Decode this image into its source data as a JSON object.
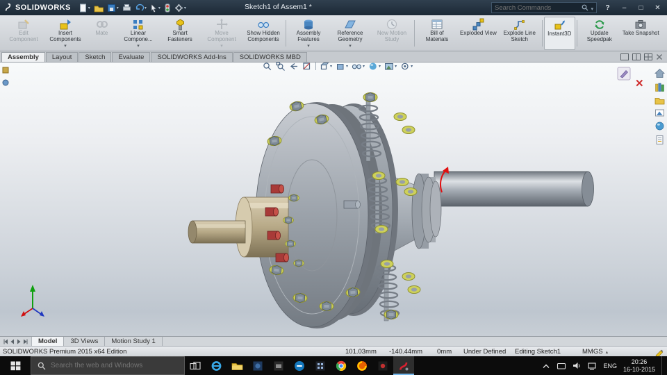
{
  "colors": {
    "titlebar_bg": "#1f2d3b",
    "ribbon_bg": "#d3d7db",
    "viewport_top": "#f8fafb",
    "viewport_bottom": "#c4ccd4",
    "taskbar_bg": "#0c0c0c",
    "taskbar_active_underline": "#76b9ed",
    "washer_yellow": "#c9cc55",
    "bushing_red": "#a83a38",
    "triad_x_red": "#d01010",
    "triad_y_green": "#0fa00f",
    "triad_z_blue": "#2038c0",
    "drag_arrow_red": "#e01010"
  },
  "titlebar": {
    "app_name": "SOLIDWORKS",
    "document_title": "Sketch1 of Assem1 *",
    "search_placeholder": "Search Commands",
    "help_label": "?",
    "minimize_label": "–",
    "maximize_label": "□",
    "close_label": "✕"
  },
  "ribbon": {
    "buttons": [
      {
        "label": "Edit Component",
        "enabled": false,
        "dropdown": false
      },
      {
        "label": "Insert Components",
        "enabled": true,
        "dropdown": true
      },
      {
        "label": "Mate",
        "enabled": false,
        "dropdown": false
      },
      {
        "label": "Linear Compone...",
        "enabled": true,
        "dropdown": true
      },
      {
        "label": "Smart Fasteners",
        "enabled": true,
        "dropdown": false
      },
      {
        "label": "Move Component",
        "enabled": false,
        "dropdown": true
      },
      {
        "label": "Show Hidden Components",
        "enabled": true,
        "dropdown": false
      },
      {
        "label": "Assembly Features",
        "enabled": true,
        "dropdown": true
      },
      {
        "label": "Reference Geometry",
        "enabled": true,
        "dropdown": true
      },
      {
        "label": "New Motion Study",
        "enabled": false,
        "dropdown": false
      },
      {
        "label": "Bill of Materials",
        "enabled": true,
        "dropdown": false
      },
      {
        "label": "Exploded View",
        "enabled": true,
        "dropdown": false
      },
      {
        "label": "Explode Line Sketch",
        "enabled": true,
        "dropdown": false
      },
      {
        "label": "Instant3D",
        "enabled": true,
        "dropdown": false
      },
      {
        "label": "Update Speedpak",
        "enabled": true,
        "dropdown": false
      },
      {
        "label": "Take Snapshot",
        "enabled": true,
        "dropdown": false
      }
    ]
  },
  "command_tabs": [
    {
      "label": "Assembly",
      "active": true
    },
    {
      "label": "Layout",
      "active": false
    },
    {
      "label": "Sketch",
      "active": false
    },
    {
      "label": "Evaluate",
      "active": false
    },
    {
      "label": "SOLIDWORKS Add-Ins",
      "active": false
    },
    {
      "label": "SOLIDWORKS MBD",
      "active": false
    }
  ],
  "viewport": {
    "close_sketch_label": "✕",
    "bottom_tabs": [
      {
        "label": "Model",
        "active": true
      },
      {
        "label": "3D Views",
        "active": false
      },
      {
        "label": "Motion Study 1",
        "active": false
      }
    ]
  },
  "task_pane_icons": [
    "home-icon",
    "design-library-icon",
    "file-explorer-icon",
    "view-palette-icon",
    "appearances-icon",
    "custom-properties-icon"
  ],
  "heads_up_icons": [
    "zoom-fit-icon",
    "zoom-area-icon",
    "previous-view-icon",
    "section-view-icon",
    "view-orientation-icon",
    "display-style-icon",
    "hide-show-items-icon",
    "edit-appearance-icon",
    "apply-scene-icon",
    "view-settings-icon"
  ],
  "statusbar": {
    "edition": "SOLIDWORKS Premium 2015 x64 Edition",
    "coord_x": "101.03mm",
    "coord_y": "-140.44mm",
    "coord_z": "0mm",
    "sketch_state": "Under Defined",
    "editing": "Editing Sketch1",
    "units": "MMGS"
  },
  "taskbar": {
    "search_placeholder": "Search the web and Windows",
    "app_icons": [
      "start-icon",
      "task-view-icon",
      "edge-icon",
      "file-explorer-icon",
      "photos-app-icon",
      "store-app-icon",
      "hp-app-icon",
      "calculator-app-icon",
      "chrome-icon",
      "firefox-icon",
      "media-app-icon",
      "solidworks-app-icon"
    ],
    "language": "ENG",
    "time": "20:26",
    "date": "16-10-2015"
  }
}
